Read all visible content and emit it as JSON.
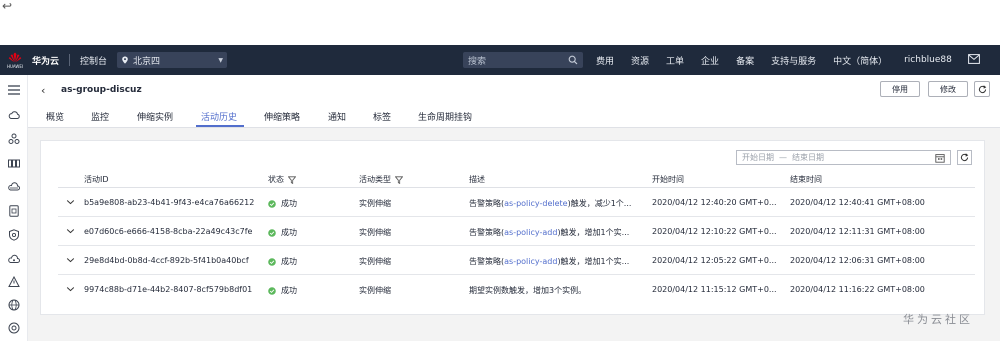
{
  "window": {
    "back_arrow": "↩"
  },
  "topnav": {
    "brand": "华为云",
    "console": "控制台",
    "region": "北京四",
    "search_placeholder": "搜索",
    "menu": [
      "费用",
      "资源",
      "工单",
      "企业",
      "备案",
      "支持与服务",
      "中文（简体）",
      "richblue88"
    ],
    "icons": [
      "huawei-logo",
      "location-pin-icon",
      "search-icon",
      "mail-icon"
    ]
  },
  "header": {
    "title": "as-group-discuz",
    "buttons": {
      "disable": "停用",
      "modify": "修改"
    }
  },
  "tabs": [
    {
      "label": "概览"
    },
    {
      "label": "监控"
    },
    {
      "label": "伸缩实例"
    },
    {
      "label": "活动历史",
      "active": true
    },
    {
      "label": "伸缩策略"
    },
    {
      "label": "通知"
    },
    {
      "label": "标签"
    },
    {
      "label": "生命周期挂钩"
    }
  ],
  "filter": {
    "start_placeholder": "开始日期",
    "separator": "—",
    "end_placeholder": "结束日期"
  },
  "table": {
    "headers": {
      "id": "活动ID",
      "status": "状态",
      "type": "活动类型",
      "desc": "描述",
      "start": "开始时间",
      "end": "结束时间"
    },
    "rows": [
      {
        "id": "b5a9e808-ab23-4b41-9f43-e4ca76a66212",
        "status": "成功",
        "type": "实例伸缩",
        "desc_pre": "告警策略(",
        "desc_link": "as-policy-delete",
        "desc_post": ")触发，减少1个...",
        "start": "2020/04/12 12:40:20 GMT+0...",
        "end": "2020/04/12 12:40:41 GMT+08:00"
      },
      {
        "id": "e07d60c6-e666-4158-8cba-22a49c43c7fe",
        "status": "成功",
        "type": "实例伸缩",
        "desc_pre": "告警策略(",
        "desc_link": "as-policy-add",
        "desc_post": ")触发，增加1个实...",
        "start": "2020/04/12 12:10:22 GMT+0...",
        "end": "2020/04/12 12:11:31 GMT+08:00"
      },
      {
        "id": "29e8d4bd-0b8d-4ccf-892b-5f41b0a40bcf",
        "status": "成功",
        "type": "实例伸缩",
        "desc_pre": "告警策略(",
        "desc_link": "as-policy-add",
        "desc_post": ")触发，增加1个实...",
        "start": "2020/04/12 12:05:22 GMT+0...",
        "end": "2020/04/12 12:06:31 GMT+08:00"
      },
      {
        "id": "9974c88b-d71e-44b2-8407-8cf579b8df01",
        "status": "成功",
        "type": "实例伸缩",
        "desc_pre": "期望实例数触发，增加3个实例。",
        "desc_link": "",
        "desc_post": "",
        "start": "2020/04/12 11:15:12 GMT+0...",
        "end": "2020/04/12 11:16:22 GMT+08:00"
      }
    ]
  },
  "watermark": "华为云社区",
  "colors": {
    "nav_bg": "#1f2a3c",
    "accent": "#526ecc",
    "success": "#5cb85c",
    "brand_red": "#c7000b"
  }
}
